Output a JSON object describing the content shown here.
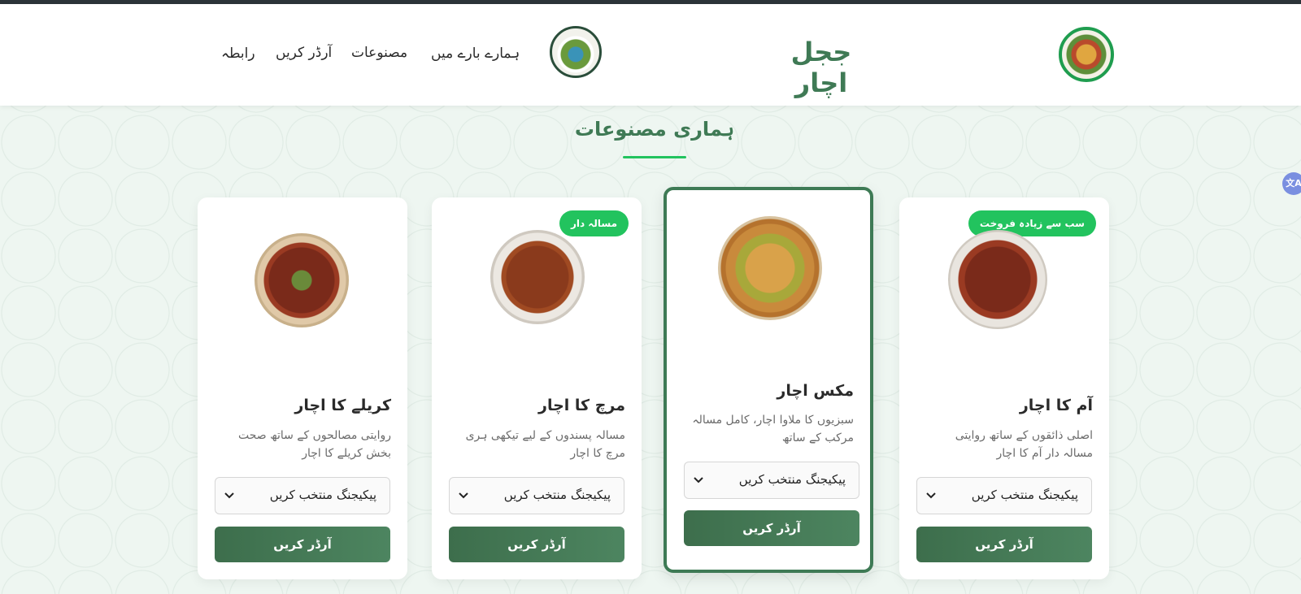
{
  "header": {
    "brand": "ججل اچار",
    "nav": [
      "ہمارے بارے میں",
      "مصنوعات",
      "آرڈر کریں",
      "رابطہ"
    ]
  },
  "section": {
    "title": "ہماری مصنوعات"
  },
  "products": [
    {
      "title": "آم کا اچار",
      "badge": "سب سے زیادہ فروخت",
      "desc": "اصلی ذائقوں کے ساتھ روایتی مسالہ دار آم کا اچار",
      "select": "پیکیجنگ منتخب کریں",
      "button": "آرڈر کریں"
    },
    {
      "title": "مکس اچار",
      "badge": "",
      "desc": "سبزیوں کا ملاوا اچار، کامل مسالہ مرکب کے ساتھ",
      "select": "پیکیجنگ منتخب کریں",
      "button": "آرڈر کریں"
    },
    {
      "title": "مرچ کا اچار",
      "badge": "مسالہ دار",
      "desc": "مسالہ پسندوں کے لیے تیکھی ہری مرچ کا اچار",
      "select": "پیکیجنگ منتخب کریں",
      "button": "آرڈر کریں"
    },
    {
      "title": "کریلے کا اچار",
      "badge": "",
      "desc": "روایتی مصالحوں کے ساتھ صحت بخش کریلے کا اچار",
      "select": "پیکیجنگ منتخب کریں",
      "button": "آرڈر کریں"
    }
  ],
  "colors": {
    "brand": "#3f7a55",
    "accent": "#22c35e",
    "button": "#3d6e4c"
  },
  "icons": {
    "translate": "translate-icon",
    "chevron": "chevron-down-icon"
  }
}
